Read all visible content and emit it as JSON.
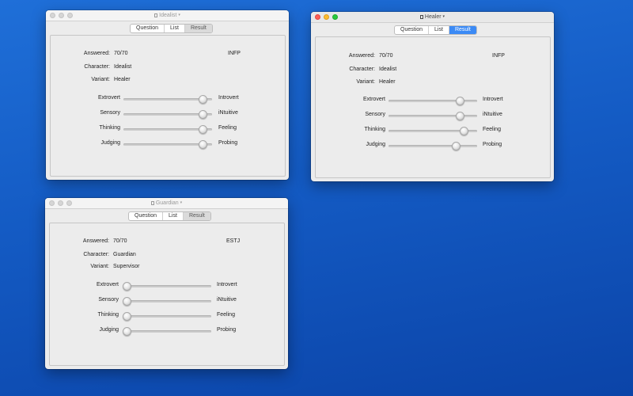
{
  "segments": [
    "Question",
    "List",
    "Result"
  ],
  "windows": [
    {
      "title": "Idealist",
      "answered_label": "Answered:",
      "answered": "70/70",
      "type": "INFP",
      "character_label": "Character:",
      "character": "Idealist",
      "variant_label": "Variant:",
      "variant": "Healer",
      "sliders": [
        {
          "left": "Extrovert",
          "right": "Introvert",
          "value": 0.94
        },
        {
          "left": "Sensory",
          "right": "iNtuitive",
          "value": 0.94
        },
        {
          "left": "Thinking",
          "right": "Feeling",
          "value": 0.94
        },
        {
          "left": "Judging",
          "right": "Probing",
          "value": 0.94
        }
      ]
    },
    {
      "title": "Healer",
      "answered_label": "Answered:",
      "answered": "70/70",
      "type": "INFP",
      "character_label": "Character:",
      "character": "Idealist",
      "variant_label": "Variant:",
      "variant": "Healer",
      "sliders": [
        {
          "left": "Extrovert",
          "right": "Introvert",
          "value": 0.84
        },
        {
          "left": "Sensory",
          "right": "iNtuitive",
          "value": 0.84
        },
        {
          "left": "Thinking",
          "right": "Feeling",
          "value": 0.89
        },
        {
          "left": "Judging",
          "right": "Probing",
          "value": 0.79
        }
      ]
    },
    {
      "title": "Guardian",
      "answered_label": "Answered:",
      "answered": "70/70",
      "type": "ESTJ",
      "character_label": "Character:",
      "character": "Guardian",
      "variant_label": "Variant:",
      "variant": "Supervisor",
      "sliders": [
        {
          "left": "Extrovert",
          "right": "Introvert",
          "value": 0.0
        },
        {
          "left": "Sensory",
          "right": "iNtuitive",
          "value": 0.0
        },
        {
          "left": "Thinking",
          "right": "Feeling",
          "value": 0.0
        },
        {
          "left": "Judging",
          "right": "Probing",
          "value": 0.0
        }
      ]
    }
  ]
}
